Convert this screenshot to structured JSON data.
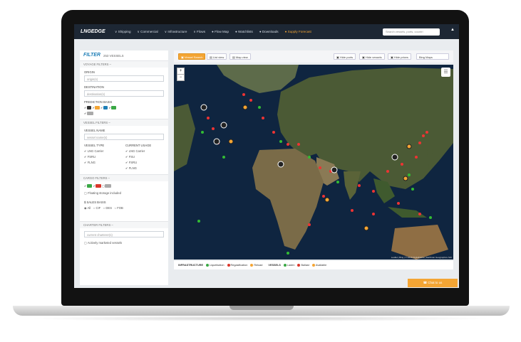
{
  "nav": {
    "brand": "LNGEDGE",
    "items": [
      {
        "label": "∨ Shipping"
      },
      {
        "label": "∨ Commercial"
      },
      {
        "label": "∨ Infrastructure"
      },
      {
        "label": "∨ Flows"
      },
      {
        "label": "● Flow Map"
      },
      {
        "label": "● Watchlists"
      },
      {
        "label": "● Downloads"
      },
      {
        "label": "● Supply Forecast"
      }
    ],
    "search_placeholder": "Search vessels, ports, countri",
    "user_icon": "user-icon"
  },
  "sidebar": {
    "filter_title": "FILTER",
    "filter_count": "253 VESSELS",
    "voyage_filters": "VOYAGE FILTERS –",
    "origin_label": "ORIGIN",
    "origin_placeholder": "origin(s)",
    "destination_label": "DESTINATION",
    "destination_placeholder": "destination(s)",
    "prediction_label": "PREDICTION BASIS",
    "vessel_filters": "VESSEL FILTERS –",
    "vessel_name_label": "VESSEL NAME",
    "vessel_name_placeholder": "vessel name(s)",
    "vessel_type_label": "VESSEL TYPE",
    "current_usage_label": "CURRENT USAGE",
    "vessel_types": [
      "LNG Carrier",
      "FSRU",
      "FLNG"
    ],
    "current_usages": [
      "LNG Carrier",
      "FSU",
      "FSRU",
      "FLNG"
    ],
    "cargo_filters": "CARGO FILTERS –",
    "floating_storage": "Floating storage included",
    "sales_basis_label": "$ SALES BASIS",
    "sales_basis": [
      "All",
      "CIF",
      "DES",
      "FOB"
    ],
    "charter_filters": "CHARTER FILTERS –",
    "charterer_placeholder": "current charterer(s)",
    "actively_marketed": "Actively marketed vessels"
  },
  "toolbar": {
    "view1": "▣ Vessel Search",
    "view2": "▤ List view",
    "view3": "▤ Map view",
    "hide_ports": "▣ Hide ports",
    "hide_vessels": "▣ Hide vessels",
    "hide_prices": "▣ Hide prices",
    "basemap": "Bing Maps"
  },
  "map": {
    "zoom_in": "+",
    "zoom_out": "−",
    "layers_icon": "layers-icon",
    "attribution": "Leaflet | Bing | © 2018 DigitalGlobe | Earthstar Geographics SIO"
  },
  "legend": {
    "infra_label": "INFRASTRUCTURE",
    "items": [
      "Liquefaction",
      "Regasification",
      "Reload"
    ],
    "vessels_label": "VESSELS",
    "vessel_items": [
      "Laden",
      "Ballast",
      "Available"
    ]
  },
  "chat": {
    "label": "☎ Chat to us"
  },
  "colors": {
    "accent": "#f4a534",
    "navbar": "#1d2734",
    "brand_blue": "#1f7fb7",
    "land": "#4b5a35",
    "sea": "#0f2540"
  }
}
